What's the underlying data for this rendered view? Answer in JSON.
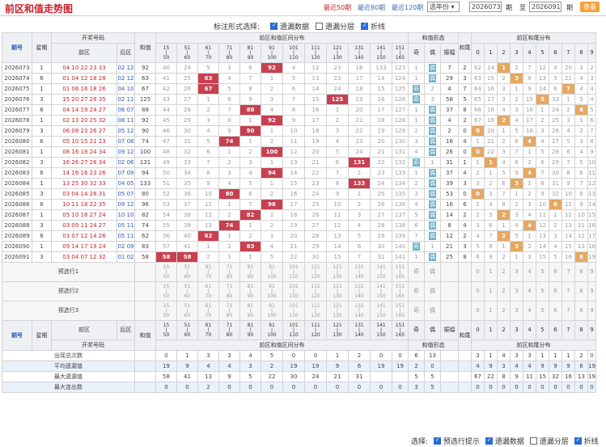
{
  "header": {
    "title": "前区和值走势图",
    "recent": [
      "最近50期",
      "最近80期",
      "最近120期"
    ],
    "year_select": "选年份",
    "from_period": "2026073",
    "period_label": "期",
    "to_label": "至",
    "to_period": "2026091",
    "query": "查看"
  },
  "options": {
    "label": "标注形式选择:",
    "items": [
      {
        "label": "遗漏数据",
        "checked": true
      },
      {
        "label": "遗漏分层",
        "checked": false
      },
      {
        "label": "折线",
        "checked": true
      }
    ]
  },
  "cols": {
    "period": "期号",
    "week": "星期",
    "draw": "开奖号码",
    "front": "前区",
    "back": "后区",
    "sum": "和值",
    "dist": "前区和值区间分布",
    "form": "和值形态",
    "odd": "奇",
    "even": "偶",
    "amp": "振幅",
    "tail": "和尾",
    "taildist": "前区和尾分布",
    "ranges_top": [
      "15",
      "51",
      "61",
      "71",
      "81",
      "91",
      "101",
      "111",
      "121",
      "131",
      "141",
      "151"
    ],
    "ranges_tilde": [
      "|",
      "|",
      "|",
      "|",
      "|",
      "|",
      "|",
      "|",
      "|",
      "|",
      "|",
      "|"
    ],
    "ranges_bottom": [
      "50",
      "60",
      "70",
      "80",
      "90",
      "100",
      "110",
      "120",
      "130",
      "140",
      "150",
      "165"
    ],
    "tails": [
      "0",
      "1",
      "2",
      "3",
      "4",
      "5",
      "6",
      "7",
      "8",
      "9"
    ]
  },
  "rows": [
    {
      "p": "2026073",
      "w": "1",
      "f": "04 10 22 23 33",
      "b": "02 12",
      "s": "92",
      "d": [
        "40",
        "24",
        "5",
        "3",
        "6",
        "92",
        "4",
        "12",
        "23",
        "16",
        "133",
        "123"
      ],
      "fo": [
        "1",
        "偶"
      ],
      "a": "7",
      "t": "2",
      "td": [
        "62",
        "14",
        "1",
        "2",
        "7",
        "12",
        "4",
        "20",
        "3",
        "2"
      ]
    },
    {
      "p": "2026074",
      "w": "6",
      "f": "01 04 12 18 28",
      "b": "02 12",
      "s": "63",
      "d": [
        "41",
        "25",
        "63",
        "4",
        "7",
        "1",
        "5",
        "13",
        "23",
        "17",
        "14",
        "124"
      ],
      "fo": [
        "1",
        "偶"
      ],
      "a": "29",
      "t": "3",
      "td": [
        "63",
        "15",
        "2",
        "3",
        "8",
        "13",
        "5",
        "21",
        "4",
        "3"
      ]
    },
    {
      "p": "2026075",
      "w": "1",
      "f": "01 06 16 18 26",
      "b": "04 10",
      "s": "67",
      "d": [
        "42",
        "26",
        "67",
        "5",
        "8",
        "2",
        "6",
        "14",
        "24",
        "18",
        "15",
        "125"
      ],
      "fo": [
        "奇",
        "2"
      ],
      "a": "4",
      "t": "7",
      "td": [
        "64",
        "16",
        "3",
        "1",
        "9",
        "14",
        "6",
        "7",
        "4",
        "4"
      ]
    },
    {
      "p": "2026076",
      "w": "3",
      "f": "15 20 27 28 35",
      "b": "02 11",
      "s": "125",
      "d": [
        "43",
        "27",
        "1",
        "6",
        "9",
        "3",
        "7",
        "15",
        "125",
        "19",
        "16",
        "126"
      ],
      "fo": [
        "奇",
        "3"
      ],
      "a": "58",
      "t": "5",
      "td": [
        "65",
        "17",
        "3",
        "2",
        "15",
        "5",
        "33",
        "1",
        "5",
        "4"
      ]
    },
    {
      "p": "2026077",
      "w": "6",
      "f": "04 14 19 24 27",
      "b": "06 07",
      "s": "88",
      "d": [
        "44",
        "28",
        "2",
        "7",
        "88",
        "4",
        "8",
        "16",
        "1",
        "20",
        "17",
        "127"
      ],
      "fo": [
        "1",
        "偶"
      ],
      "a": "37",
      "t": "8",
      "td": [
        "66",
        "18",
        "4",
        "3",
        "16",
        "1",
        "24",
        "2",
        "8",
        "5"
      ]
    },
    {
      "p": "2026078",
      "w": "1",
      "f": "02 13 20 25 32",
      "b": "08 11",
      "s": "92",
      "d": [
        "45",
        "29",
        "3",
        "8",
        "1",
        "92",
        "9",
        "17",
        "2",
        "21",
        "18",
        "128"
      ],
      "fo": [
        "1",
        "偶"
      ],
      "a": "4",
      "t": "2",
      "td": [
        "67",
        "19",
        "2",
        "4",
        "17",
        "2",
        "25",
        "3",
        "1",
        "6"
      ]
    },
    {
      "p": "2026079",
      "w": "3",
      "f": "06 08 23 26 27",
      "b": "05 12",
      "s": "90",
      "d": [
        "46",
        "30",
        "4",
        "9",
        "90",
        "1",
        "10",
        "18",
        "3",
        "22",
        "19",
        "129"
      ],
      "fo": [
        "2",
        "偶"
      ],
      "a": "2",
      "t": "0",
      "td": [
        "0",
        "20",
        "1",
        "5",
        "18",
        "3",
        "26",
        "4",
        "2",
        "7"
      ]
    },
    {
      "p": "2026080",
      "w": "6",
      "f": "05 10 15 21 23",
      "b": "07 08",
      "s": "74",
      "d": [
        "47",
        "31",
        "5",
        "74",
        "1",
        "2",
        "11",
        "19",
        "4",
        "23",
        "20",
        "130"
      ],
      "fo": [
        "3",
        "偶"
      ],
      "a": "16",
      "t": "4",
      "td": [
        "1",
        "21",
        "2",
        "6",
        "4",
        "4",
        "27",
        "5",
        "3",
        "8"
      ]
    },
    {
      "p": "2026081",
      "w": "1",
      "f": "08 16 18 24 34",
      "b": "09 12",
      "s": "100",
      "d": [
        "48",
        "32",
        "6",
        "1",
        "2",
        "100",
        "12",
        "20",
        "5",
        "24",
        "21",
        "131"
      ],
      "fo": [
        "4",
        "偶"
      ],
      "a": "26",
      "t": "0",
      "td": [
        "0",
        "22",
        "3",
        "7",
        "1",
        "5",
        "28",
        "6",
        "4",
        "9"
      ]
    },
    {
      "p": "2026082",
      "w": "3",
      "f": "16 26 27 28 34",
      "b": "02 06",
      "s": "131",
      "d": [
        "49",
        "33",
        "7",
        "2",
        "3",
        "1",
        "13",
        "21",
        "6",
        "131",
        "22",
        "132"
      ],
      "fo": [
        "奇",
        "1"
      ],
      "a": "31",
      "t": "1",
      "td": [
        "1",
        "1",
        "4",
        "8",
        "2",
        "6",
        "29",
        "7",
        "5",
        "10"
      ]
    },
    {
      "p": "2026083",
      "w": "6",
      "f": "14 16 16 23 26",
      "b": "07 09",
      "s": "94",
      "d": [
        "50",
        "34",
        "8",
        "3",
        "4",
        "94",
        "14",
        "22",
        "7",
        "1",
        "23",
        "133"
      ],
      "fo": [
        "1",
        "偶"
      ],
      "a": "37",
      "t": "4",
      "td": [
        "2",
        "1",
        "5",
        "9",
        "4",
        "7",
        "30",
        "8",
        "6",
        "11"
      ]
    },
    {
      "p": "2026084",
      "w": "1",
      "f": "13 25 30 32 33",
      "b": "04 05",
      "s": "133",
      "d": [
        "51",
        "35",
        "9",
        "4",
        "5",
        "1",
        "15",
        "23",
        "8",
        "133",
        "24",
        "134"
      ],
      "fo": [
        "2",
        "偶"
      ],
      "a": "39",
      "t": "3",
      "td": [
        "3",
        "2",
        "6",
        "3",
        "1",
        "8",
        "31",
        "9",
        "7",
        "12"
      ]
    },
    {
      "p": "2026085",
      "w": "3",
      "f": "03 04 14 28 31",
      "b": "05 07",
      "s": "80",
      "d": [
        "52",
        "36",
        "10",
        "80",
        "6",
        "2",
        "16",
        "24",
        "9",
        "1",
        "25",
        "135"
      ],
      "fo": [
        "3",
        "偶"
      ],
      "a": "53",
      "t": "0",
      "td": [
        "0",
        "3",
        "7",
        "1",
        "2",
        "9",
        "32",
        "10",
        "8",
        "13"
      ]
    },
    {
      "p": "2026086",
      "w": "6",
      "f": "10 11 18 22 35",
      "b": "09 12",
      "s": "96",
      "d": [
        "53",
        "37",
        "11",
        "1",
        "7",
        "96",
        "17",
        "25",
        "10",
        "2",
        "26",
        "136"
      ],
      "fo": [
        "4",
        "偶"
      ],
      "a": "16",
      "t": "6",
      "td": [
        "1",
        "4",
        "8",
        "2",
        "3",
        "10",
        "6",
        "11",
        "9",
        "14"
      ]
    },
    {
      "p": "2026087",
      "w": "1",
      "f": "05 10 16 27 24",
      "b": "10 10",
      "s": "82",
      "d": [
        "54",
        "38",
        "12",
        "2",
        "82",
        "1",
        "18",
        "26",
        "11",
        "3",
        "27",
        "137"
      ],
      "fo": [
        "5",
        "偶"
      ],
      "a": "14",
      "t": "2",
      "td": [
        "2",
        "5",
        "2",
        "3",
        "4",
        "11",
        "1",
        "12",
        "10",
        "15"
      ]
    },
    {
      "p": "2026088",
      "w": "3",
      "f": "03 09 11 24 27",
      "b": "05 11",
      "s": "74",
      "d": [
        "55",
        "39",
        "13",
        "74",
        "1",
        "2",
        "19",
        "27",
        "12",
        "4",
        "28",
        "138"
      ],
      "fo": [
        "6",
        "偶"
      ],
      "a": "8",
      "t": "4",
      "td": [
        "3",
        "6",
        "1",
        "4",
        "4",
        "12",
        "2",
        "13",
        "11",
        "16"
      ]
    },
    {
      "p": "2026089",
      "w": "6",
      "f": "03 07 12 14 26",
      "b": "05 11",
      "s": "62",
      "d": [
        "56",
        "40",
        "62",
        "1",
        "2",
        "3",
        "20",
        "28",
        "13",
        "5",
        "29",
        "139"
      ],
      "fo": [
        "7",
        "偶"
      ],
      "a": "12",
      "t": "2",
      "td": [
        "4",
        "7",
        "2",
        "5",
        "1",
        "13",
        "3",
        "14",
        "12",
        "17"
      ]
    },
    {
      "p": "2026090",
      "w": "1",
      "f": "09 14 17 19 24",
      "b": "02 09",
      "s": "83",
      "d": [
        "57",
        "41",
        "1",
        "2",
        "83",
        "4",
        "21",
        "29",
        "14",
        "6",
        "30",
        "140"
      ],
      "fo": [
        "奇",
        "1"
      ],
      "a": "21",
      "t": "3",
      "td": [
        "5",
        "8",
        "1",
        "3",
        "2",
        "14",
        "4",
        "15",
        "13",
        "18"
      ]
    },
    {
      "p": "2026091",
      "w": "3",
      "f": "03 04 07 12 32",
      "b": "01 02",
      "s": "58",
      "d": [
        "58",
        "58",
        "2",
        "3",
        "1",
        "5",
        "22",
        "30",
        "15",
        "7",
        "31",
        "141"
      ],
      "fo": [
        "1",
        "偶"
      ],
      "a": "25",
      "t": "8",
      "td": [
        "6",
        "9",
        "2",
        "1",
        "3",
        "15",
        "5",
        "16",
        "8",
        "19"
      ]
    }
  ],
  "preview": [
    "预选行1",
    "预选行2",
    "预选行3"
  ],
  "preview_tails": [
    "0",
    "1",
    "2",
    "3",
    "4",
    "5",
    "6",
    "7",
    "8",
    "9"
  ],
  "preview_form": [
    "奇",
    "偶"
  ],
  "stats": [
    {
      "label": "出现总次数",
      "d": [
        "0",
        "1",
        "3",
        "3",
        "4",
        "5",
        "0",
        "0",
        "1",
        "2",
        "0",
        "0"
      ],
      "fo": [
        "6",
        "13"
      ],
      "td": [
        "3",
        "1",
        "4",
        "3",
        "3",
        "1",
        "1",
        "1",
        "2",
        "0"
      ]
    },
    {
      "label": "平均遗漏值",
      "d": [
        "19",
        "9",
        "4",
        "4",
        "3",
        "2",
        "19",
        "19",
        "9",
        "6",
        "19",
        "19"
      ],
      "fo": [
        "2",
        "0"
      ],
      "td": [
        "4",
        "9",
        "3",
        "4",
        "4",
        "9",
        "9",
        "9",
        "6",
        "19"
      ]
    },
    {
      "label": "最大遗漏值",
      "d": [
        "58",
        "41",
        "13",
        "9",
        "5",
        "22",
        "30",
        "24",
        "21",
        "31",
        "",
        ""
      ],
      "fo": [
        "5",
        "5"
      ],
      "td": [
        "67",
        "22",
        "8",
        "9",
        "11",
        "15",
        "32",
        "16",
        "13",
        "19"
      ]
    },
    {
      "label": "最大连出数",
      "d": [
        "0",
        "0",
        "2",
        "0",
        "0",
        "0",
        "0",
        "0",
        "0",
        "0",
        "0",
        "0"
      ],
      "fo": [
        "3",
        "5"
      ],
      "td": [
        "0",
        "0",
        "0",
        "0",
        "0",
        "0",
        "0",
        "0",
        "0",
        "0"
      ]
    }
  ],
  "footer": {
    "label": "选择:",
    "items": [
      {
        "label": "预选行提示",
        "checked": true
      },
      {
        "label": "遗漏数据",
        "checked": true
      },
      {
        "label": "遗漏分层",
        "checked": false
      },
      {
        "label": "折线",
        "checked": true
      }
    ]
  }
}
